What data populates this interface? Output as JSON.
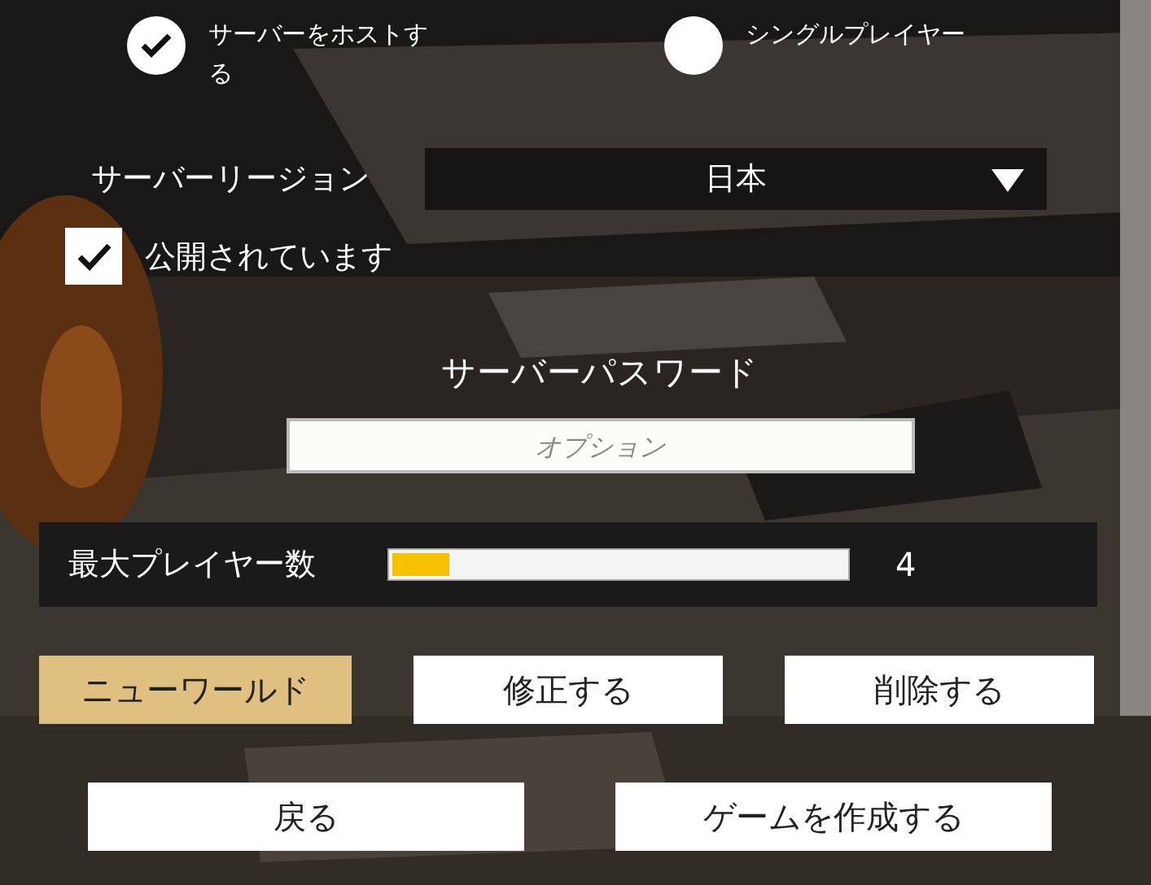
{
  "mode_options": [
    {
      "label": "サーバーをホストする",
      "selected": true
    },
    {
      "label": "シングルプレイヤー",
      "selected": false
    }
  ],
  "server_region": {
    "label": "サーバーリージョン",
    "value": "日本"
  },
  "public": {
    "label": "公開されています",
    "checked": true
  },
  "password": {
    "label": "サーバーパスワード",
    "placeholder": "オプション"
  },
  "max_players": {
    "label": "最大プレイヤー数",
    "level": 0.14,
    "reading": "4"
  },
  "world_buttons": [
    {
      "label": "ニューワールド",
      "selected": true
    },
    {
      "label": "修正する",
      "selected": false
    },
    {
      "label": "削除する",
      "selected": false
    }
  ],
  "bottom_buttons": [
    {
      "label": "戻る"
    },
    {
      "label": "ゲームを作成する"
    }
  ]
}
